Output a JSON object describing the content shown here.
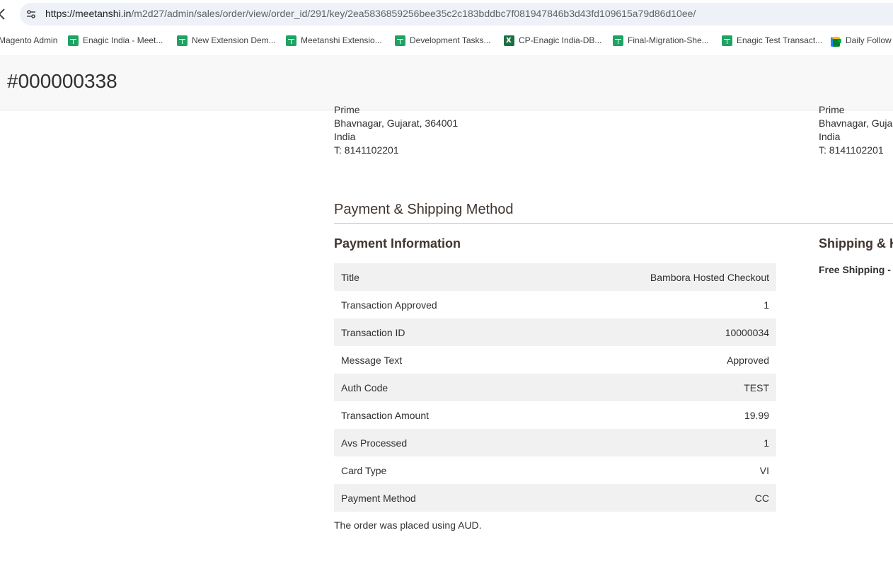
{
  "browser": {
    "url_host": "https://meetanshi.in",
    "url_path": "/m2d27/admin/sales/order/view/order_id/291/key/2ea5836859256bee35c2c183bddbc7f081947846b3d43fd109615a79d86d10ee/",
    "bookmarks": [
      {
        "label": "Magento Admin",
        "icon": "none"
      },
      {
        "label": "Enagic India - Meet...",
        "icon": "sheets-icon"
      },
      {
        "label": "New Extension Dem...",
        "icon": "sheets-icon"
      },
      {
        "label": "Meetanshi Extensio...",
        "icon": "sheets-icon"
      },
      {
        "label": "Development Tasks...",
        "icon": "sheets-icon"
      },
      {
        "label": "CP-Enagic India-DB...",
        "icon": "excel-icon"
      },
      {
        "label": "Final-Migration-She...",
        "icon": "sheets-icon"
      },
      {
        "label": "Enagic Test Transact...",
        "icon": "sheets-icon"
      },
      {
        "label": "Daily Follow",
        "icon": "meet-icon"
      }
    ]
  },
  "page": {
    "title": "#000000338"
  },
  "billing_address": {
    "line_partial": "Prime",
    "city_line": "Bhavnagar, Gujarat, 364001",
    "country": "India",
    "phone": "T: 8141102201"
  },
  "shipping_address": {
    "line_partial": "Prime",
    "city_line": "Bhavnagar, Guja",
    "country": "India",
    "phone": "T: 8141102201"
  },
  "payment_shipping": {
    "section_title": "Payment & Shipping Method",
    "payment_info_title": "Payment Information",
    "shipping_title": "Shipping & H",
    "shipping_method": "Free Shipping -",
    "rows": [
      {
        "label": "Title",
        "value": "Bambora Hosted Checkout"
      },
      {
        "label": "Transaction Approved",
        "value": "1"
      },
      {
        "label": "Transaction ID",
        "value": "10000034"
      },
      {
        "label": "Message Text",
        "value": "Approved"
      },
      {
        "label": "Auth Code",
        "value": "TEST"
      },
      {
        "label": "Transaction Amount",
        "value": "19.99"
      },
      {
        "label": "Avs Processed",
        "value": "1"
      },
      {
        "label": "Card Type",
        "value": "VI"
      },
      {
        "label": "Payment Method",
        "value": "CC"
      }
    ],
    "currency_note": "The order was placed using AUD."
  }
}
